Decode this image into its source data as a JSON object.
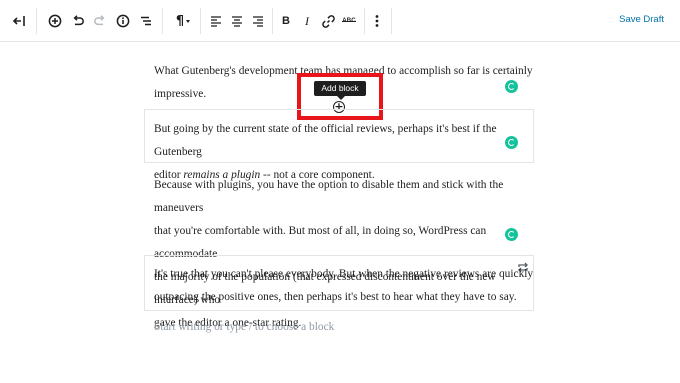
{
  "toolbar": {
    "save_label": "Save Draft",
    "icons": [
      "back-icon",
      "add-icon",
      "undo-icon",
      "redo-icon",
      "info-icon",
      "outline-icon",
      "paragraph-icon",
      "align-left-icon",
      "align-center-icon",
      "align-right-icon",
      "bold-icon",
      "italic-icon",
      "link-icon",
      "strikethrough-icon",
      "more-icon"
    ],
    "strikethrough_text": "ABC",
    "bold_text": "B",
    "italic_text": "I",
    "paragraph_text": "¶"
  },
  "tooltip": {
    "label": "Add block"
  },
  "blocks": [
    {
      "lines": [
        "What Gutenberg's development team has managed to accomplish so far is certainly",
        "impressive."
      ]
    },
    {
      "before": "But going by the current state of the official reviews, perhaps it's best if the Gutenberg",
      "line2_start": "editor ",
      "emphasis": "remains a plugin",
      "line2_end": " -- not a core component."
    },
    {
      "lines": [
        "Because with plugins, you have the option to disable them and stick with the maneuvers",
        "that you're comfortable with. But most of all, in doing so, WordPress can accommodate",
        "the majority of the population (that expressed discontentment over the new interface) who",
        "gave the editor a one-star rating."
      ]
    },
    {
      "lines": [
        "It's true that you can't please everybody. But when the negative reviews are quickly",
        "outpacing the positive ones, then perhaps it's best to hear what they have to say."
      ]
    }
  ],
  "placeholder": "Start writing or type / to choose a block",
  "colors": {
    "accent": "#0073aa",
    "grammarly": "#15c39a",
    "highlight": "#e8161b"
  }
}
